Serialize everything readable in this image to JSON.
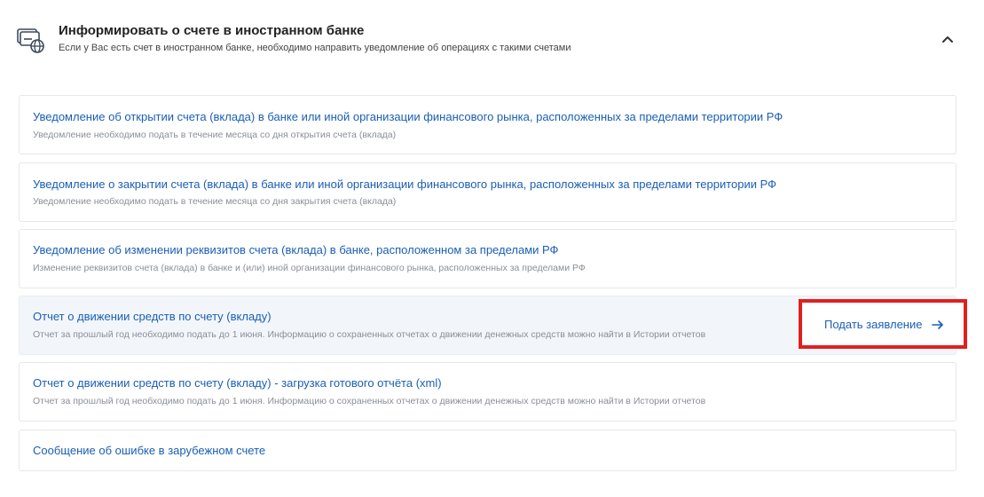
{
  "header": {
    "icon": "bank-card-globe-icon",
    "title": "Информировать о счете в иностранном банке",
    "subtitle": "Если у Вас есть счет в иностранном банке, необходимо направить уведомление об операциях с такими счетами",
    "collapse_icon": "chevron-up-icon"
  },
  "items": [
    {
      "title": "Уведомление об открытии счета (вклада) в банке или иной организации финансового рынка, расположенных за пределами территории РФ",
      "subtitle": "Уведомление необходимо подать в течение месяца со дня открытия счета (вклада)"
    },
    {
      "title": "Уведомление о закрытии счета (вклада) в банке или иной организации финансового рынка, расположенных за пределами территории РФ",
      "subtitle": "Уведомление необходимо подать в течение месяца со дня закрытия счета (вклада)"
    },
    {
      "title": "Уведомление об изменении реквизитов счета (вклада) в банке, расположенном за пределами РФ",
      "subtitle": "Изменение реквизитов счета (вклада) в банке и (или) иной организации финансового рынка, расположенных за пределами РФ"
    },
    {
      "title": "Отчет о движении средств по счету (вкладу)",
      "subtitle": "Отчет за прошлый год необходимо подать до 1 июня. Информацию о сохраненных отчетах о движении денежных средств можно найти в Истории отчетов",
      "action_label": "Подать заявление",
      "action_icon": "arrow-right-icon"
    },
    {
      "title": "Отчет о движении средств по счету (вкладу) - загрузка готового отчёта (xml)",
      "subtitle": "Отчет за прошлый год необходимо подать до 1 июня. Информацию о сохраненных отчетах о движении денежных средств можно найти в Истории отчетов"
    },
    {
      "title": "Сообщение об ошибке в зарубежном счете"
    }
  ],
  "colors": {
    "link": "#1a5fb4",
    "highlight_bg": "#f2f6fb",
    "focus_frame": "#e0201f"
  }
}
